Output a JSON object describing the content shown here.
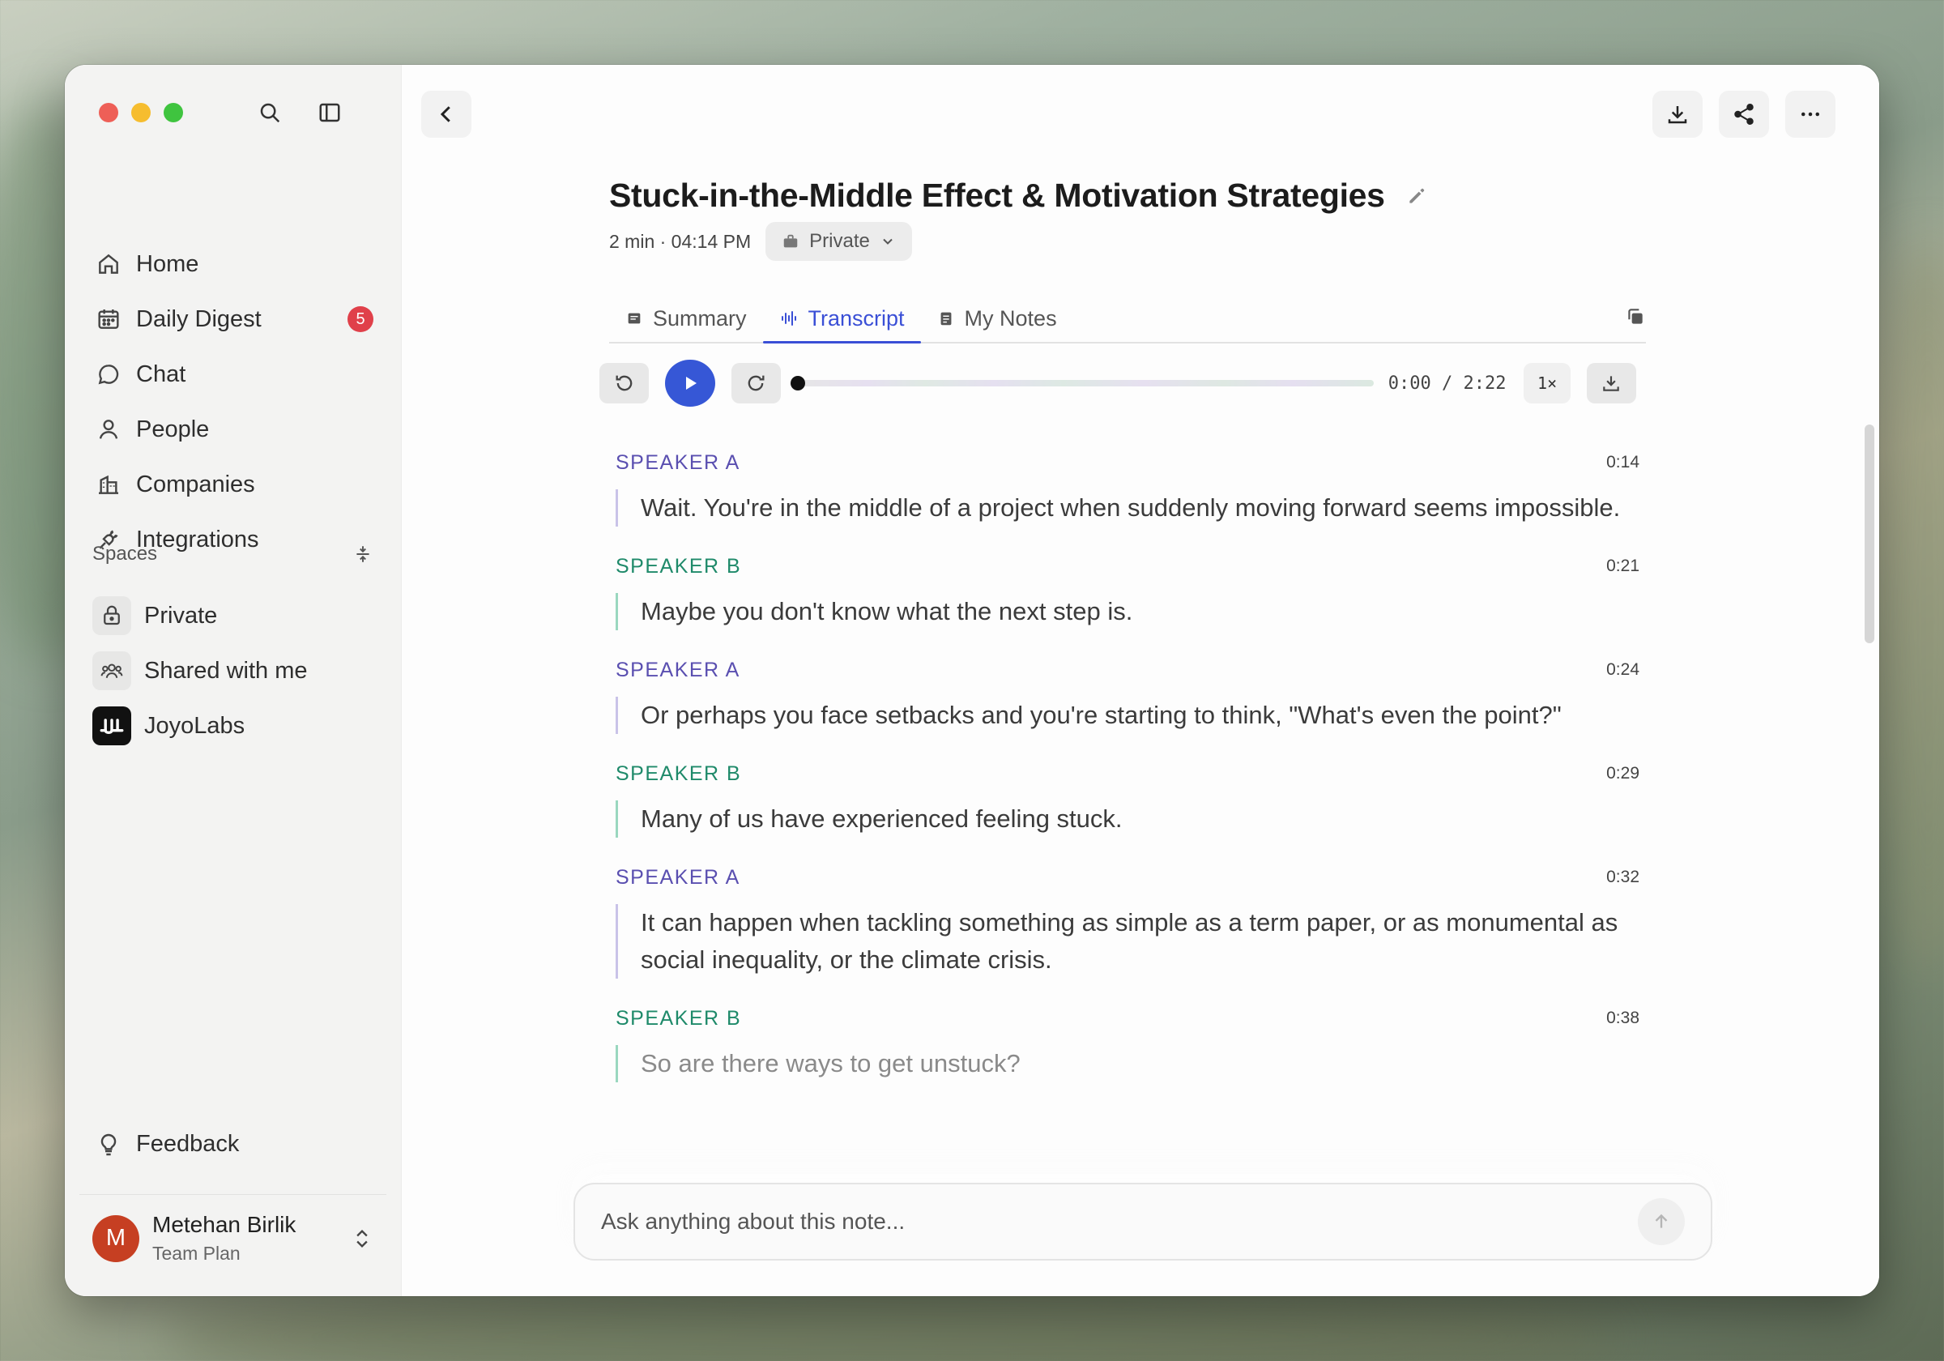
{
  "sidebar": {
    "nav": [
      {
        "label": "Home",
        "icon": "home-icon"
      },
      {
        "label": "Daily Digest",
        "icon": "calendar-icon",
        "badge": "5"
      },
      {
        "label": "Chat",
        "icon": "chat-icon"
      },
      {
        "label": "People",
        "icon": "person-icon"
      },
      {
        "label": "Companies",
        "icon": "building-icon"
      },
      {
        "label": "Integrations",
        "icon": "plug-icon"
      }
    ],
    "spaces_heading": "Spaces",
    "spaces": [
      {
        "label": "Private",
        "icon": "lock-icon"
      },
      {
        "label": "Shared with me",
        "icon": "group-icon"
      },
      {
        "label": "JoyoLabs",
        "icon": "joyolabs-logo"
      }
    ],
    "feedback_label": "Feedback",
    "user": {
      "initial": "M",
      "name": "Metehan Birlik",
      "plan": "Team Plan"
    }
  },
  "note": {
    "title": "Stuck-in-the-Middle Effect & Motivation Strategies",
    "meta": "2 min · 04:14 PM",
    "visibility": "Private"
  },
  "tabs": [
    {
      "label": "Summary",
      "active": false
    },
    {
      "label": "Transcript",
      "active": true
    },
    {
      "label": "My Notes",
      "active": false
    }
  ],
  "player": {
    "time": "0:00 / 2:22",
    "speed": "1×",
    "progress": 0
  },
  "transcript": [
    {
      "speaker": "SPEAKER A",
      "time": "0:14",
      "text": "Wait. You're in the middle of a project when suddenly moving forward seems impossible."
    },
    {
      "speaker": "SPEAKER B",
      "time": "0:21",
      "text": "Maybe you don't know what the next step is."
    },
    {
      "speaker": "SPEAKER A",
      "time": "0:24",
      "text": "Or perhaps you face setbacks and you're starting to think, \"What's even the point?\""
    },
    {
      "speaker": "SPEAKER B",
      "time": "0:29",
      "text": "Many of us have experienced feeling stuck."
    },
    {
      "speaker": "SPEAKER A",
      "time": "0:32",
      "text": "It can happen when tackling something as simple as a term paper, or as monumental as social inequality, or the climate crisis."
    },
    {
      "speaker": "SPEAKER B",
      "time": "0:38",
      "text": "So are there ways to get unstuck?"
    }
  ],
  "ask": {
    "placeholder": "Ask anything about this note..."
  },
  "colors": {
    "accent": "#3657d6",
    "speaker_a": "#5a4fb0",
    "speaker_b": "#1f8a6a",
    "badge": "#e0404a",
    "avatar": "#c63f22"
  }
}
